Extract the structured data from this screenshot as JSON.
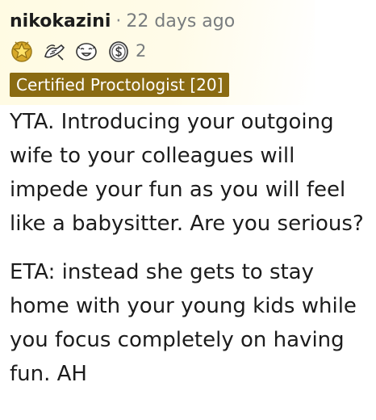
{
  "comment": {
    "username": "nikokazini",
    "separator": "·",
    "timestamp": "22 days ago",
    "awards": [
      {
        "icon": "gold-star-award-icon"
      },
      {
        "icon": "hugz-award-icon"
      },
      {
        "icon": "laughing-face-award-icon"
      },
      {
        "icon": "silver-coin-award-icon"
      }
    ],
    "award_count": "2",
    "flair": "Certified Proctologist [20]",
    "body": [
      "YTA. Introducing your outgoing wife to your colleagues will impede your fun as you will feel like a babysitter. Are you serious?",
      "ETA: instead she gets to stay home with your young kids while you focus completely on having fun. AH"
    ]
  },
  "colors": {
    "flair_background": "#8a6b12",
    "header_highlight": "#fffbe3",
    "timestamp": "#787c7e"
  }
}
